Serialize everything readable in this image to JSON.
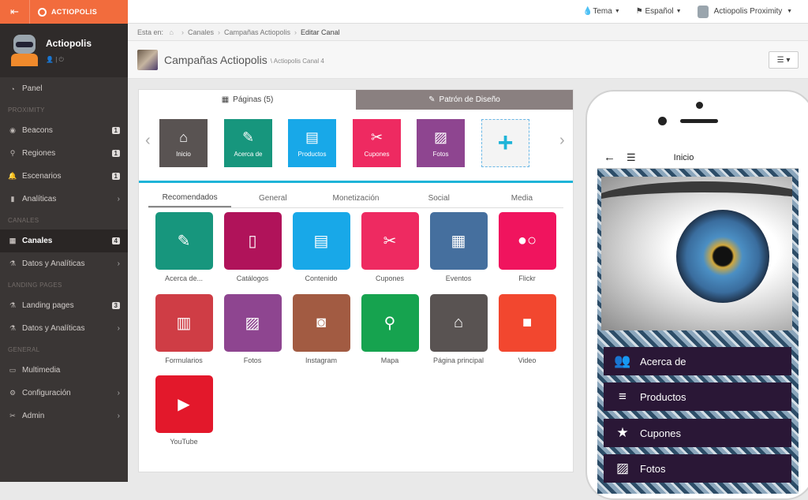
{
  "brand": {
    "name": "ACTIOPOLIS",
    "toggle_icon": "sidebar-toggle-icon",
    "logo_icon": "actiopolis-logo-icon"
  },
  "profile": {
    "name": "Actiopolis",
    "avatar_icon": "robot-avatar-icon"
  },
  "topbar": {
    "theme": "Tema",
    "language": "Español",
    "user": "Actiopolis Proximity"
  },
  "breadcrumb": {
    "lead": "Esta en:",
    "items": [
      "Canales",
      "Campañas Actiopolis",
      "Editar Canal"
    ]
  },
  "page": {
    "title": "Campañas Actiopolis",
    "subtitle": "\\ Actiopolis Canal 4"
  },
  "sidebar": {
    "items": [
      {
        "label": "Panel",
        "icon": "dashboard-icon"
      },
      {
        "section": "PROXIMITY"
      },
      {
        "label": "Beacons",
        "icon": "beacon-icon",
        "badge": "1"
      },
      {
        "label": "Regiones",
        "icon": "map-pin-icon",
        "badge": "1"
      },
      {
        "label": "Escenarios",
        "icon": "bell-icon",
        "badge": "1"
      },
      {
        "label": "Analíticas",
        "icon": "bar-chart-icon",
        "chevron": true
      },
      {
        "section": "CANALES"
      },
      {
        "label": "Canales",
        "icon": "grid-icon",
        "badge": "4",
        "active": true
      },
      {
        "label": "Datos y Analíticas",
        "icon": "flask-icon",
        "chevron": true
      },
      {
        "section": "LANDING PAGES"
      },
      {
        "label": "Landing pages",
        "icon": "flask-icon",
        "badge": "3"
      },
      {
        "label": "Datos y Analíticas",
        "icon": "flask-icon",
        "chevron": true
      },
      {
        "section": "GENERAL"
      },
      {
        "label": "Multimedia",
        "icon": "folder-icon"
      },
      {
        "label": "Configuración",
        "icon": "sliders-icon",
        "chevron": true
      },
      {
        "label": "Admin",
        "icon": "wrench-icon",
        "chevron": true
      }
    ]
  },
  "editor": {
    "tabs": [
      {
        "label": "Páginas (5)",
        "icon": "grid-icon"
      },
      {
        "label": "Patrón de Diseño",
        "icon": "brush-icon"
      }
    ],
    "pages": [
      {
        "label": "Inicio",
        "color": "#595352",
        "icon": "home-icon"
      },
      {
        "label": "Acerca de",
        "color": "#17967d",
        "icon": "edit-icon"
      },
      {
        "label": "Productos",
        "color": "#18a8e8",
        "icon": "newspaper-icon"
      },
      {
        "label": "Cupones",
        "color": "#ee2a61",
        "icon": "scissors-icon"
      },
      {
        "label": "Fotos",
        "color": "#8e4590",
        "icon": "image-icon"
      }
    ],
    "add_icon": "plus-icon",
    "subtabs": [
      "Recomendados",
      "General",
      "Monetización",
      "Social",
      "Media"
    ],
    "modules": [
      {
        "label": "Acerca de...",
        "color": "#17967d",
        "icon": "edit-icon"
      },
      {
        "label": "Catálogos",
        "color": "#b0135a",
        "icon": "book-icon"
      },
      {
        "label": "Contenido",
        "color": "#18a8e8",
        "icon": "newspaper-icon"
      },
      {
        "label": "Cupones",
        "color": "#ee2a61",
        "icon": "scissors-icon"
      },
      {
        "label": "Eventos",
        "color": "#456f9e",
        "icon": "calendar-icon"
      },
      {
        "label": "Flickr",
        "color": "#f0145e",
        "icon": "flickr-icon"
      },
      {
        "label": "Formularios",
        "color": "#cf3d45",
        "icon": "notebook-icon"
      },
      {
        "label": "Fotos",
        "color": "#8e4590",
        "icon": "image-icon"
      },
      {
        "label": "Instagram",
        "color": "#a25b42",
        "icon": "instagram-icon"
      },
      {
        "label": "Mapa",
        "color": "#16a34f",
        "icon": "map-pin-icon"
      },
      {
        "label": "Página principal",
        "color": "#595352",
        "icon": "home-icon"
      },
      {
        "label": "Video",
        "color": "#f2472f",
        "icon": "video-icon"
      },
      {
        "label": "YouTube",
        "color": "#e3182b",
        "icon": "youtube-icon"
      }
    ]
  },
  "preview": {
    "title": "Inicio",
    "items": [
      {
        "label": "Acerca de",
        "icon": "users-icon"
      },
      {
        "label": "Productos",
        "icon": "list-icon"
      },
      {
        "label": "Cupones",
        "icon": "star-icon"
      },
      {
        "label": "Fotos",
        "icon": "image-icon"
      }
    ]
  },
  "accent": "#1fb4d8"
}
